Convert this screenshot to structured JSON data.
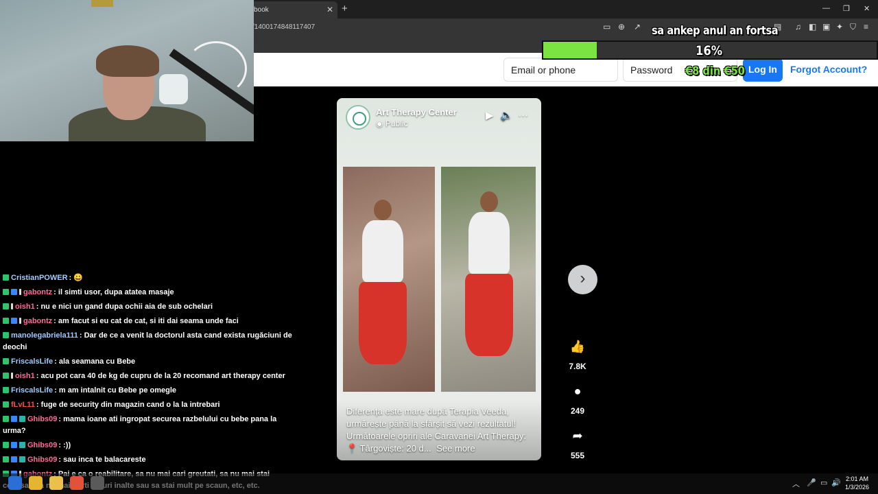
{
  "browser": {
    "tab_title": "book",
    "url": "/1400174848117407"
  },
  "fb_header": {
    "email_placeholder": "Email or phone",
    "password_placeholder": "Password",
    "login_label": "Log In",
    "forgot_label": "Forgot Account?",
    "brand_color": "#1877f2"
  },
  "stream_overlay": {
    "goal_title": "sa ankep anul an fortsa",
    "goal_percent_label": "16%",
    "goal_fraction": 0.16,
    "goal_amount": "€8 din €50",
    "bar_color": "#7be342"
  },
  "video": {
    "author": "Art Therapy Center",
    "audience": "Public",
    "caption": "Diferența este mare după Terapia Veeda, urmărește până la sfârșit să vezi rezultatul! Următoarele opriri ale Caravanei Art Therapy: 📍 Târgoviște: 20 d...",
    "see_more": "See more",
    "likes": "7.8K",
    "comments": "249",
    "shares": "555"
  },
  "chat": {
    "messages": [
      {
        "user": "CristianPOWER",
        "color": "#9ecbff",
        "badges": [
          "k"
        ],
        "text": ": 😀"
      },
      {
        "user": "gabontz",
        "color": "#ff6b9a",
        "badges": [
          "k",
          "p",
          "i"
        ],
        "text": ": il simti usor, dupa atatea masaje"
      },
      {
        "user": "oish1",
        "color": "#ff6b9a",
        "badges": [
          "k",
          "i"
        ],
        "text": ": nu e nici un gand dupa ochii aia de sub ochelari"
      },
      {
        "user": "gabontz",
        "color": "#ff6b9a",
        "badges": [
          "k",
          "p",
          "i"
        ],
        "text": ": am facut si eu cat de cat, si iti dai seama unde faci"
      },
      {
        "user": "manolegabriela111",
        "color": "#9ecbff",
        "badges": [
          "k"
        ],
        "text": ": Dar de ce a venit la doctorul asta cand exista rugăciuni de deochi"
      },
      {
        "user": "FriscalsLife",
        "color": "#9ecbff",
        "badges": [
          "k"
        ],
        "text": ": ala seamana cu Bebe"
      },
      {
        "user": "oish1",
        "color": "#ff6b9a",
        "badges": [
          "k",
          "i"
        ],
        "text": ": acu pot cara 40 de kg de cupru de la 20 recomand art therapy center"
      },
      {
        "user": "FriscalsLife",
        "color": "#9ecbff",
        "badges": [
          "k"
        ],
        "text": ": m am intalnit cu Bebe pe omegle"
      },
      {
        "user": "fLvL11",
        "color": "#ff4a4a",
        "badges": [
          "k"
        ],
        "text": ": fuge de security din magazin cand o la la intrebari"
      },
      {
        "user": "Ghibs09",
        "color": "#ff6b9a",
        "badges": [
          "k",
          "p",
          "g"
        ],
        "text": ": mama ioane ati ingropat securea razbelului cu bebe pana la urma?"
      },
      {
        "user": "Ghibs09",
        "color": "#ff6b9a",
        "badges": [
          "k",
          "p",
          "g"
        ],
        "text": ": :))"
      },
      {
        "user": "Ghibs09",
        "color": "#ff6b9a",
        "badges": [
          "k",
          "p",
          "g"
        ],
        "text": ": sau inca te balacareste"
      },
      {
        "user": "gabontz",
        "color": "#ff6b9a",
        "badges": [
          "k",
          "p",
          "i"
        ],
        "text": ": Pai e ca o reabilitare, sa nu mai cari greutati, sa nu mai stai cocosat, sa nu mai porti tocuri inalte sau sa stai mult pe scaun, etc, etc."
      }
    ]
  },
  "taskbar": {
    "time": "2:01 AM",
    "date": "1/3/2026"
  }
}
